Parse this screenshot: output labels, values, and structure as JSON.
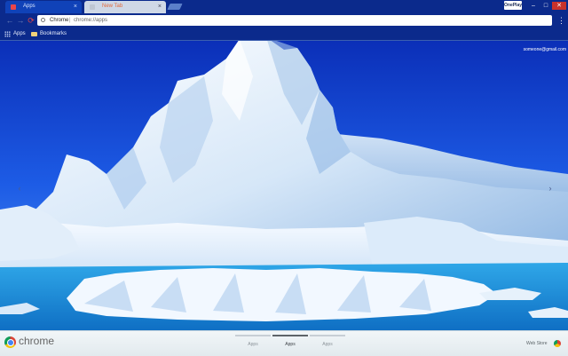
{
  "tabs": [
    {
      "label": "Apps",
      "active": true
    },
    {
      "label": "New Tab",
      "active": false
    }
  ],
  "window": {
    "user_button": "OnePlay",
    "minimize": "–",
    "maximize": "□",
    "close": "✕"
  },
  "toolbar": {
    "back": "←",
    "forward": "→",
    "reload": "⟳",
    "omnibox_origin": "Chrome",
    "omnibox_separator": "|",
    "omnibox_url": "chrome://apps",
    "menu": "⋮"
  },
  "bookmarks_bar": {
    "items": [
      {
        "label": "Apps",
        "icon": "apps-grid-icon"
      },
      {
        "label": "Bookmarks",
        "icon": "folder-icon"
      }
    ]
  },
  "ntp": {
    "user_email": "someone@gmail.com",
    "prev_arrow": "‹",
    "next_arrow": "›",
    "background": "icy iceberg under blue sky"
  },
  "footer": {
    "brand": "chrome",
    "pages": [
      {
        "label": "Apps",
        "active": false
      },
      {
        "label": "Apps",
        "active": true
      },
      {
        "label": "Apps",
        "active": false
      }
    ],
    "web_store": "Web Store"
  },
  "colors": {
    "frame": "#0b2a8c",
    "active_tab": "#1042b8",
    "inactive_tab": "#cfd8e6",
    "reload_accent": "#e0454a",
    "close_button": "#c8322b",
    "sky": "#1a4fd8",
    "ice": "#e6f1fb"
  }
}
